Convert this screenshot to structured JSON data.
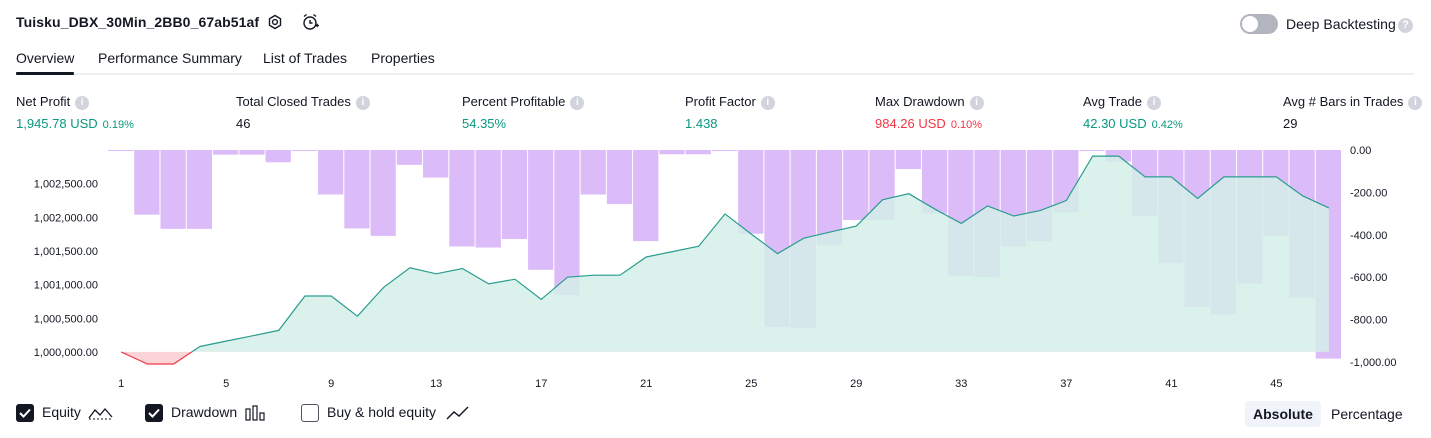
{
  "header": {
    "title": "Tuisku_DBX_30Min_2BB0_67ab51af",
    "deep_backtesting_label": "Deep Backtesting",
    "deep_backtesting_on": false,
    "help_glyph": "?"
  },
  "tabs": [
    {
      "label": "Overview",
      "active": true
    },
    {
      "label": "Performance Summary",
      "active": false
    },
    {
      "label": "List of Trades",
      "active": false
    },
    {
      "label": "Properties",
      "active": false
    }
  ],
  "metrics": [
    {
      "label": "Net Profit",
      "value": "1,945.78 USD",
      "pct": "0.19%",
      "color": "#089981"
    },
    {
      "label": "Total Closed Trades",
      "value": "46",
      "pct": "",
      "color": "#131722"
    },
    {
      "label": "Percent Profitable",
      "value": "54.35%",
      "pct": "",
      "color": "#089981"
    },
    {
      "label": "Profit Factor",
      "value": "1.438",
      "pct": "",
      "color": "#089981"
    },
    {
      "label": "Max Drawdown",
      "value": "984.26 USD",
      "pct": "0.10%",
      "color": "#f23645"
    },
    {
      "label": "Avg Trade",
      "value": "42.30 USD",
      "pct": "0.42%",
      "color": "#089981"
    },
    {
      "label": "Avg # Bars in Trades",
      "value": "29",
      "pct": "",
      "color": "#131722"
    }
  ],
  "info_glyph": "i",
  "chart_data": {
    "type": "bar",
    "x_ticks": [
      "1",
      "5",
      "9",
      "13",
      "17",
      "21",
      "25",
      "29",
      "33",
      "37",
      "41",
      "45"
    ],
    "left_axis": {
      "ticks": [
        "1,000,000.00",
        "1,000,500.00",
        "1,001,000.00",
        "1,001,500.00",
        "1,002,000.00",
        "1,002,500.00"
      ],
      "ylim": [
        999850,
        1003000
      ]
    },
    "right_axis": {
      "ticks": [
        "0.00",
        "-200.00",
        "-400.00",
        "-600.00",
        "-800.00",
        "-1,000.00"
      ],
      "ylim": [
        -1000,
        0
      ]
    },
    "series": [
      {
        "name": "Equity",
        "x": [
          1,
          2,
          3,
          4,
          5,
          6,
          7,
          8,
          9,
          10,
          11,
          12,
          13,
          14,
          15,
          16,
          17,
          18,
          19,
          20,
          21,
          22,
          23,
          24,
          25,
          26,
          27,
          28,
          29,
          30,
          31,
          32,
          33,
          34,
          35,
          36,
          37,
          38,
          39,
          40,
          41,
          42,
          43,
          44,
          45,
          46,
          47
        ],
        "values": [
          1000000,
          999820,
          999820,
          1000080,
          1000160,
          1000240,
          1000320,
          1000830,
          1000830,
          1000530,
          1000960,
          1001250,
          1001160,
          1001240,
          1001010,
          1001080,
          1000780,
          1001110,
          1001140,
          1001140,
          1001410,
          1001490,
          1001570,
          1002050,
          1001750,
          1001460,
          1001690,
          1001780,
          1001870,
          1002260,
          1002350,
          1002120,
          1001910,
          1002170,
          1002020,
          1002100,
          1002250,
          1002910,
          1002910,
          1002600,
          1002600,
          1002280,
          1002600,
          1002600,
          1002600,
          1002320,
          1002140
        ]
      },
      {
        "name": "Drawdown",
        "x": [
          1,
          2,
          3,
          4,
          5,
          6,
          7,
          8,
          9,
          10,
          11,
          12,
          13,
          14,
          15,
          16,
          17,
          18,
          19,
          20,
          21,
          22,
          23,
          24,
          25,
          26,
          27,
          28,
          29,
          30,
          31,
          32,
          33,
          34,
          35,
          36,
          37,
          38,
          39,
          40,
          41,
          42,
          43,
          44,
          45,
          46,
          47
        ],
        "values": [
          0,
          -305,
          -372,
          -372,
          -22,
          -22,
          -58,
          0,
          -210,
          -370,
          -405,
          -70,
          -130,
          -455,
          -460,
          -420,
          -565,
          -685,
          -210,
          -255,
          -430,
          -20,
          -20,
          0,
          -395,
          -835,
          -840,
          -450,
          -330,
          -330,
          -90,
          -300,
          -595,
          -600,
          -455,
          -430,
          -295,
          0,
          -55,
          -310,
          -535,
          -740,
          -775,
          -630,
          -405,
          -695,
          -984
        ]
      }
    ],
    "equity_color": "#2a9d8f",
    "equity_fill": "#d4efe9",
    "drawdown_color": "#d8b4f8",
    "grid": false
  },
  "legend": [
    {
      "label": "Equity",
      "checked": true,
      "icon": "equity-line-icon"
    },
    {
      "label": "Drawdown",
      "checked": true,
      "icon": "drawdown-bars-icon"
    },
    {
      "label": "Buy & hold equity",
      "checked": false,
      "icon": "buy-hold-line-icon"
    }
  ],
  "view_toggle": {
    "absolute": "Absolute",
    "percentage": "Percentage",
    "active": "absolute"
  }
}
